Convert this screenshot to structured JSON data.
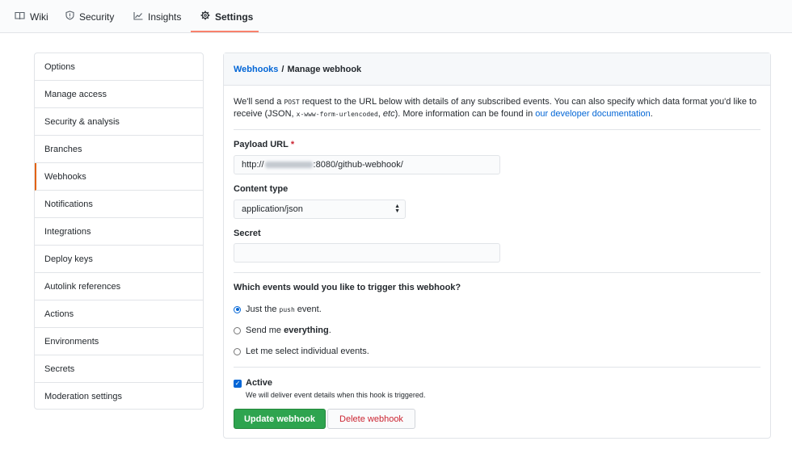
{
  "nav": {
    "tabs": [
      {
        "label": "Wiki",
        "icon": "book-icon"
      },
      {
        "label": "Security",
        "icon": "shield-icon"
      },
      {
        "label": "Insights",
        "icon": "graph-icon"
      },
      {
        "label": "Settings",
        "icon": "gear-icon",
        "selected": true
      }
    ]
  },
  "sidebar": {
    "items": [
      {
        "label": "Options"
      },
      {
        "label": "Manage access"
      },
      {
        "label": "Security & analysis"
      },
      {
        "label": "Branches"
      },
      {
        "label": "Webhooks",
        "active": true
      },
      {
        "label": "Notifications"
      },
      {
        "label": "Integrations"
      },
      {
        "label": "Deploy keys"
      },
      {
        "label": "Autolink references"
      },
      {
        "label": "Actions"
      },
      {
        "label": "Environments"
      },
      {
        "label": "Secrets"
      },
      {
        "label": "Moderation settings"
      }
    ]
  },
  "header": {
    "breadcrumb_link": "Webhooks",
    "separator": "/",
    "title": "Manage webhook"
  },
  "description": {
    "part1": "We'll send a",
    "post_code": "POST",
    "part2": "request to the URL below with details of any subscribed events. You can also specify which data format you'd like to receive (JSON,",
    "form_code": "x-www-form-urlencoded",
    "part3": ",",
    "etc": "etc",
    "part4": "). More information can be found in",
    "doc_link": "our developer documentation",
    "part5": "."
  },
  "form": {
    "payload_label": "Payload URL",
    "required_mark": "*",
    "payload_prefix": "http://",
    "payload_suffix": ":8080/github-webhook/",
    "content_type_label": "Content type",
    "content_type_value": "application/json",
    "secret_label": "Secret",
    "secret_value": ""
  },
  "events": {
    "question": "Which events would you like to trigger this webhook?",
    "options": [
      {
        "before": "Just the",
        "code": "push",
        "after": "event.",
        "checked": true
      },
      {
        "before": "Send me",
        "bold": "everything",
        "after": ".",
        "checked": false
      },
      {
        "label": "Let me select individual events.",
        "checked": false
      }
    ]
  },
  "active": {
    "label": "Active",
    "note": "We will deliver event details when this hook is triggered.",
    "checked": true
  },
  "buttons": {
    "update": "Update webhook",
    "delete": "Delete webhook"
  },
  "colors": {
    "accent_tab": "#f9826c",
    "link": "#0366d6",
    "primary_button": "#2ea44f",
    "danger_text": "#cb2431"
  }
}
